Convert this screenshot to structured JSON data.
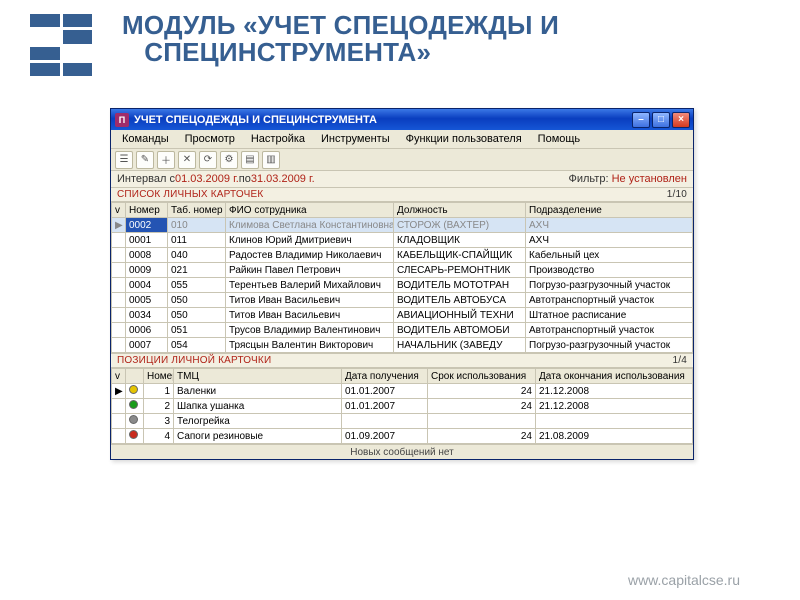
{
  "slide": {
    "title_line1": "МОДУЛЬ «УЧЕТ СПЕЦОДЕЖДЫ И",
    "title_line2": "СПЕЦИНСТРУМЕНТА»",
    "footer": "www.capitalcse.ru"
  },
  "window": {
    "title": "УЧЕТ СПЕЦОДЕЖДЫ И СПЕЦИНСТРУМЕНТА",
    "app_icon_letter": "П",
    "menu": [
      "Команды",
      "Просмотр",
      "Настройка",
      "Инструменты",
      "Функции пользователя",
      "Помощь"
    ],
    "interval_label_prefix": "Интервал с ",
    "interval_from": "01.03.2009 г.",
    "interval_mid": " по ",
    "interval_to": "31.03.2009 г.",
    "filter_label": "Фильтр: ",
    "filter_value": "Не установлен"
  },
  "cards": {
    "header": "СПИСОК ЛИЧНЫХ КАРТОЧЕК",
    "count": "1/10",
    "cols": {
      "v": "v",
      "num": "Номер",
      "tab": "Таб. номер",
      "fio": "ФИО сотрудника",
      "pos": "Должность",
      "dep": "Подразделение"
    },
    "rows": [
      {
        "mark": "▶",
        "num": "0002",
        "tab": "010",
        "fio": "Климова Светлана Константиновна",
        "pos": "СТОРОЖ (ВАХТЕР)",
        "dep": "АХЧ",
        "sel": true
      },
      {
        "mark": "",
        "num": "0001",
        "tab": "011",
        "fio": "Клинов Юрий Дмитриевич",
        "pos": "КЛАДОВЩИК",
        "dep": "АХЧ"
      },
      {
        "mark": "",
        "num": "0008",
        "tab": "040",
        "fio": "Радостев Владимир Николаевич",
        "pos": "КАБЕЛЬЩИК-СПАЙЩИК",
        "dep": "Кабельный цех"
      },
      {
        "mark": "",
        "num": "0009",
        "tab": "021",
        "fio": "Райкин Павел Петрович",
        "pos": "СЛЕСАРЬ-РЕМОНТНИК",
        "dep": "Производство"
      },
      {
        "mark": "",
        "num": "0004",
        "tab": "055",
        "fio": "Терентьев Валерий Михайлович",
        "pos": "ВОДИТЕЛЬ МОТОТРАН",
        "dep": "Погрузо-разгрузочный участок"
      },
      {
        "mark": "",
        "num": "0005",
        "tab": "050",
        "fio": "Титов Иван Васильевич",
        "pos": "ВОДИТЕЛЬ АВТОБУСА",
        "dep": "Автотранспортный участок"
      },
      {
        "mark": "",
        "num": "0034",
        "tab": "050",
        "fio": "Титов Иван Васильевич",
        "pos": "АВИАЦИОННЫЙ ТЕХНИ",
        "dep": "Штатное расписание"
      },
      {
        "mark": "",
        "num": "0006",
        "tab": "051",
        "fio": "Трусов Владимир Валентинович",
        "pos": "ВОДИТЕЛЬ АВТОМОБИ",
        "dep": "Автотранспортный участок"
      },
      {
        "mark": "",
        "num": "0007",
        "tab": "054",
        "fio": "Трясцын Валентин Викторович",
        "pos": "НАЧАЛЬНИК (ЗАВЕДУ",
        "dep": "Погрузо-разгрузочный участок"
      }
    ]
  },
  "positions": {
    "header": "ПОЗИЦИИ ЛИЧНОЙ КАРТОЧКИ",
    "count": "1/4",
    "cols": {
      "v": "v",
      "num": "Номер",
      "tmc": "ТМЦ",
      "d1": "Дата получения",
      "term": "Срок использования",
      "d2": "Дата окончания использования"
    },
    "rows": [
      {
        "mark": "▶",
        "dot": "#e5c400",
        "num": "1",
        "tmc": "Валенки",
        "d1": "01.01.2007",
        "term": "24",
        "d2": "21.12.2008"
      },
      {
        "mark": "",
        "dot": "#1a9c1a",
        "num": "2",
        "tmc": "Шапка ушанка",
        "d1": "01.01.2007",
        "term": "24",
        "d2": "21.12.2008"
      },
      {
        "mark": "",
        "dot": "#8a8a8a",
        "num": "3",
        "tmc": "Телогрейка",
        "d1": "",
        "term": "",
        "d2": ""
      },
      {
        "mark": "",
        "dot": "#c92b1e",
        "num": "4",
        "tmc": "Сапоги резиновые",
        "d1": "01.09.2007",
        "term": "24",
        "d2": "21.08.2009"
      }
    ]
  },
  "statusbar": {
    "msg": "Новых сообщений нет"
  }
}
